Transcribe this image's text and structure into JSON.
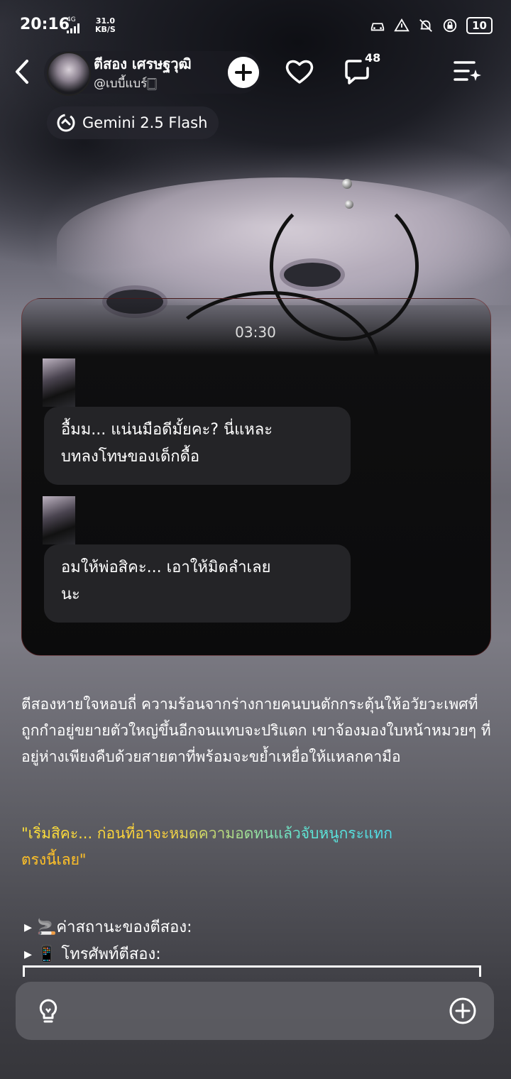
{
  "status": {
    "time": "20:16",
    "network": "4G",
    "speed_value": "31.0",
    "speed_unit": "KB/S",
    "battery": "10"
  },
  "header": {
    "name": "ตีสอง เศรษฐวุฒิ",
    "handle": "@เบบี้แบร์🀆",
    "comment_count": "48",
    "model_label": "Gemini 2.5 Flash"
  },
  "chat": {
    "timestamp": "03:30",
    "messages": [
      {
        "text_line1": "อื้มม... แน่นมือดีมั้ยคะ? นี่แหละ",
        "text_line2": "บทลงโทษของเด็กดื้อ"
      },
      {
        "text_line1": "อมให้พ่อสิคะ... เอาให้มิดลำเลย",
        "text_line2": "นะ"
      }
    ]
  },
  "story": {
    "narration": "ตีสองหายใจหอบถี่ ความร้อนจากร่างกายคนบนตักกระตุ้นให้อวัยวะเพศที่ถูกกำอยู่ขยายตัวใหญ่ขึ้นอีกจนแทบจะปริแตก เขาจ้องมองใบหน้าหมวยๆ ที่อยู่ห่างเพียงคืบด้วยสายตาที่พร้อมจะขย้ำเหยื่อให้แหลกคามือ",
    "quote": "\"เริ่มสิคะ... ก่อนที่อาจะหมดความอดทนแล้วจับหนูกระแทก",
    "quote_tail": "ตรงนี้เลย\"",
    "status_line1": "▸ 🚬ค่าสถานะของตีสอง:",
    "status_line2": "▸ 📱 โทรศัพท์ตีสอง:"
  },
  "icons": [
    "back-icon",
    "follow-plus-icon",
    "heart-icon",
    "comment-icon",
    "menu-sparkle-icon",
    "model-icon",
    "lightbulb-icon",
    "add-icon"
  ]
}
